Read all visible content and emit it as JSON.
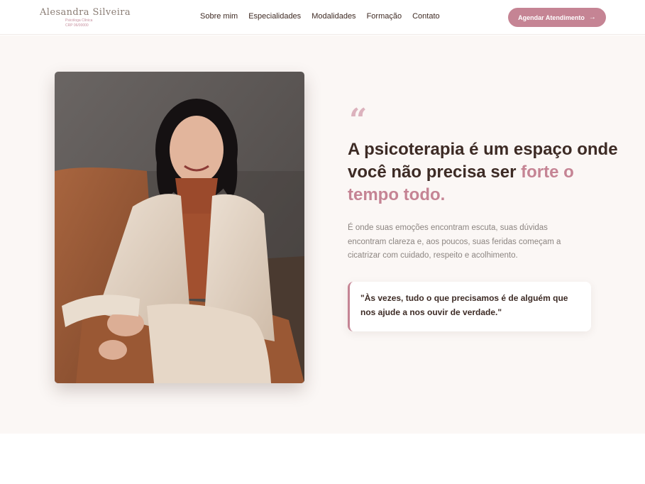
{
  "header": {
    "logo_name": "Alesandra Silveira",
    "logo_subtitle_1": "Psicóloga Clínica",
    "logo_subtitle_2": "CRP 06/00000",
    "nav": [
      "Sobre mim",
      "Especialidades",
      "Modalidades",
      "Formação",
      "Contato"
    ],
    "cta_label": "Agendar Atendimento",
    "cta_icon": "arrow-right-icon"
  },
  "hero": {
    "photo_icon": "portrait-photo",
    "quote_mark": "“",
    "headline_part1": "A psicoterapia é um espaço onde você não precisa ser ",
    "headline_accent": "forte o tempo todo.",
    "paragraph": "É onde suas emoções encontram escuta, suas dúvidas encontram clareza e, aos poucos, suas feridas começam a cicatrizar com cuidado, respeito e acolhimento.",
    "quote": "\"Às vezes, tudo o que precisamos é de alguém que nos ajude a nos ouvir de verdade.\""
  },
  "colors": {
    "accent": "#c58494",
    "text_dark": "#3d2b25",
    "hero_bg": "#fbf7f5"
  }
}
